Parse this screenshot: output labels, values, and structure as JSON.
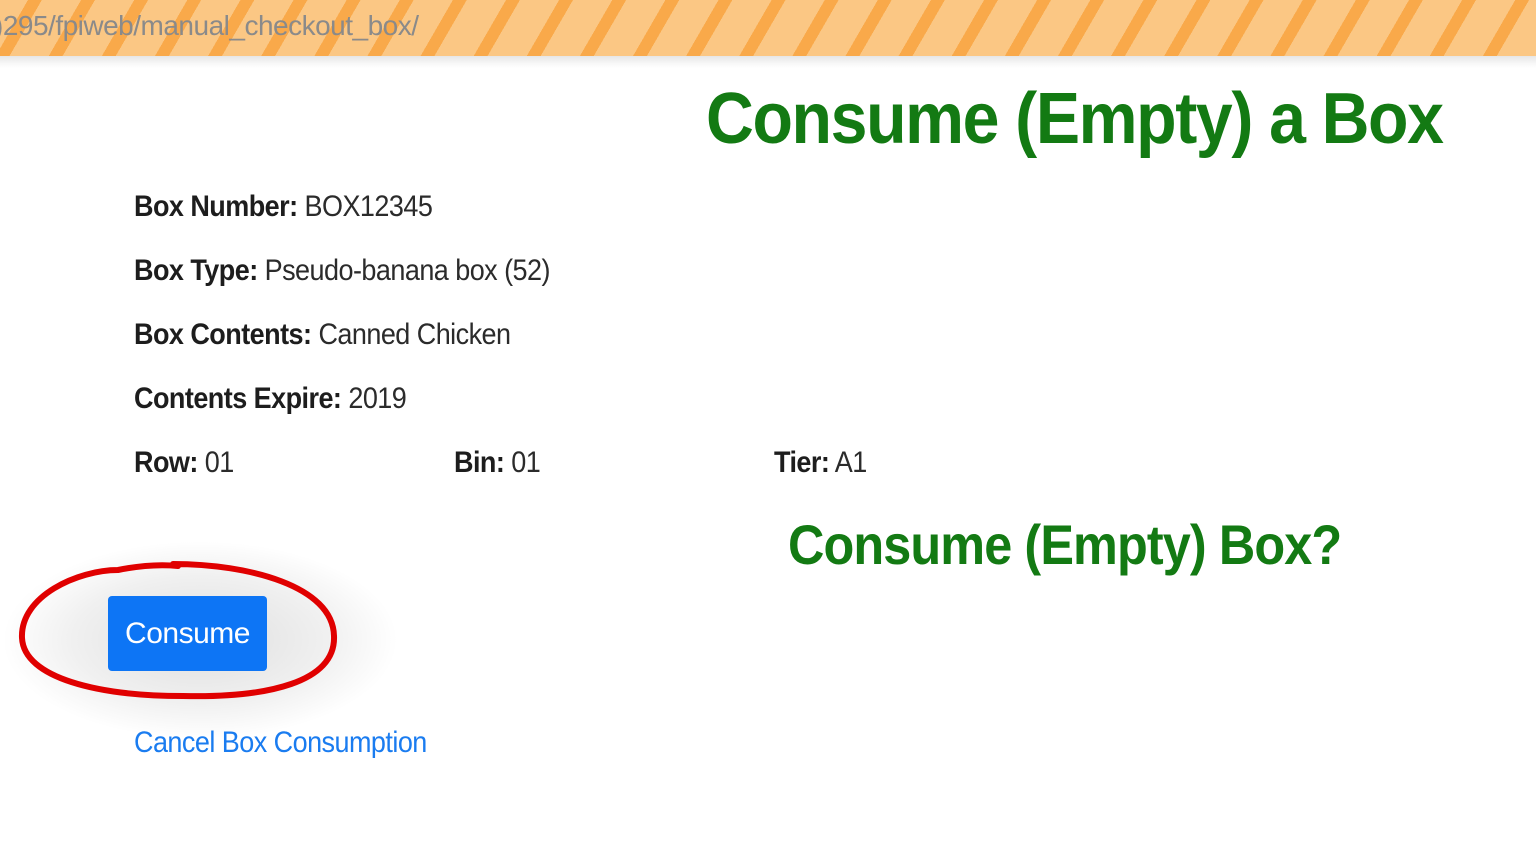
{
  "browser": {
    "url": ")295/fpiweb/manual_checkout_box/"
  },
  "page": {
    "title": "Consume (Empty) a Box"
  },
  "box": {
    "number_label": "Box Number:",
    "number_value": " BOX12345",
    "type_label": "Box Type:",
    "type_value": " Pseudo-banana box (52)",
    "contents_label": "Box Contents:",
    "contents_value": " Canned Chicken",
    "expire_label": "Contents Expire:",
    "expire_value": " 2019",
    "row_label": "Row:",
    "row_value": " 01",
    "bin_label": "Bin:",
    "bin_value": " 01",
    "tier_label": "Tier:",
    "tier_value": " A1"
  },
  "confirm": {
    "heading": "Consume (Empty) Box?",
    "consume_label": "Consume",
    "cancel_label": "Cancel Box Consumption"
  },
  "colors": {
    "heading_green": "#137a13",
    "button_blue": "#0d75f5",
    "link_blue": "#1a7cf0",
    "annotation_red": "#e00000",
    "url_stripe_light": "#fbc784",
    "url_stripe_dark": "#f9a94a"
  }
}
